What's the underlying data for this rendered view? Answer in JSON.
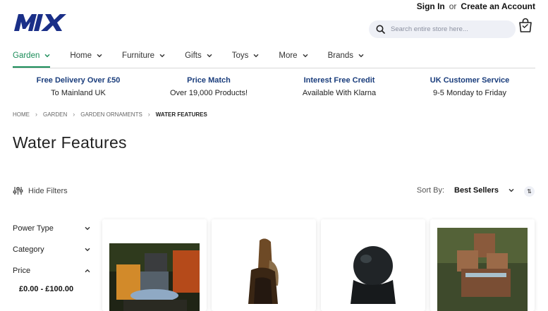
{
  "header": {
    "sign_in": "Sign In",
    "or": "or",
    "create_account": "Create an Account",
    "search_placeholder": "Search entire store here..."
  },
  "nav": [
    {
      "label": "Garden",
      "active": true
    },
    {
      "label": "Home"
    },
    {
      "label": "Furniture"
    },
    {
      "label": "Gifts"
    },
    {
      "label": "Toys"
    },
    {
      "label": "More"
    },
    {
      "label": "Brands"
    }
  ],
  "usp": [
    {
      "title": "Free Delivery Over £50",
      "subtitle": "To Mainland UK"
    },
    {
      "title": "Price Match",
      "subtitle": "Over 19,000 Products!"
    },
    {
      "title": "Interest Free Credit",
      "subtitle": "Available With Klarna"
    },
    {
      "title": "UK Customer Service",
      "subtitle": "9-5 Monday to Friday"
    }
  ],
  "breadcrumb": [
    "HOME",
    "GARDEN",
    "GARDEN ORNAMENTS",
    "WATER FEATURES"
  ],
  "page_title": "Water Features",
  "toolbar": {
    "hide_filters": "Hide Filters",
    "sort_label": "Sort By:",
    "sort_value": "Best Sellers"
  },
  "filters": {
    "power_type": "Power Type",
    "category": "Category",
    "price": "Price",
    "price_option": "£0.00 - £100.00"
  },
  "colors": {
    "brand_blue": "#1a3d7c",
    "active_green": "#1a8c58"
  }
}
